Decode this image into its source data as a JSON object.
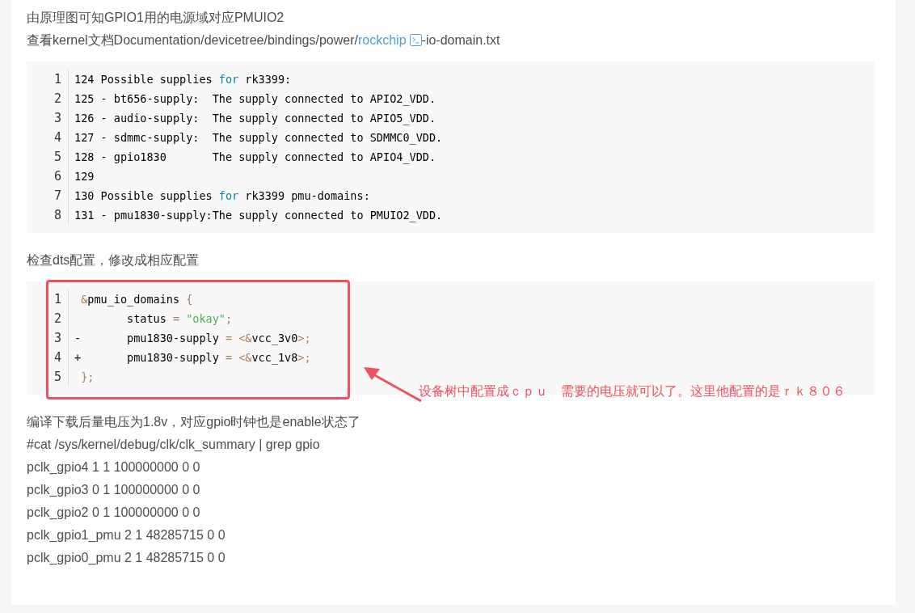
{
  "blocks": [
    {
      "kind": "text",
      "text": "由原理图可知GPIO1用的电源域对应PMUIO2"
    },
    {
      "kind": "link_text",
      "before": "查看kernel文档Documentation/devicetree/bindings/power/",
      "link": "rockchip",
      "after": "-io-domain.txt"
    },
    {
      "kind": "code",
      "lines": [
        {
          "number": "1",
          "tokens": [
            {
              "kind": "plain",
              "text": "124 Possible supplies "
            },
            {
              "kind": "keyword",
              "text": "for"
            },
            {
              "kind": "plain",
              "text": " rk3399:"
            }
          ]
        },
        {
          "number": "2",
          "tokens": [
            {
              "kind": "plain",
              "text": "125 - bt656-supply:  The supply connected to APIO2_VDD."
            }
          ]
        },
        {
          "number": "3",
          "tokens": [
            {
              "kind": "plain",
              "text": "126 - audio-supply:  The supply connected to APIO5_VDD."
            }
          ]
        },
        {
          "number": "4",
          "tokens": [
            {
              "kind": "plain",
              "text": "127 - sdmmc-supply:  The supply connected to SDMMC0_VDD."
            }
          ]
        },
        {
          "number": "5",
          "tokens": [
            {
              "kind": "plain",
              "text": "128 - gpio1830       The supply connected to APIO4_VDD."
            }
          ]
        },
        {
          "number": "6",
          "tokens": [
            {
              "kind": "plain",
              "text": "129"
            }
          ]
        },
        {
          "number": "7",
          "tokens": [
            {
              "kind": "plain",
              "text": "130 Possible supplies "
            },
            {
              "kind": "keyword",
              "text": "for"
            },
            {
              "kind": "plain",
              "text": " rk3399 pmu-domains:"
            }
          ]
        },
        {
          "number": "8",
          "tokens": [
            {
              "kind": "plain",
              "text": "131 - pmu1830-supply:The supply connected to PMUIO2_VDD."
            }
          ]
        }
      ]
    },
    {
      "kind": "text",
      "text": "检查dts配置，修改成相应配置"
    },
    {
      "kind": "code",
      "annotation": {
        "text": "设备树中配置成ｃｐｕ　需要的电压就可以了。这里他配置的是ｒｋ８０６"
      },
      "lines": [
        {
          "number": "1",
          "tokens": [
            {
              "kind": "punct",
              "text": " &"
            },
            {
              "kind": "plain",
              "text": "pmu_io_domains "
            },
            {
              "kind": "punct",
              "text": "{"
            }
          ]
        },
        {
          "number": "2",
          "tokens": [
            {
              "kind": "plain",
              "text": "        status "
            },
            {
              "kind": "punct",
              "text": "= "
            },
            {
              "kind": "string",
              "text": "\"okay\""
            },
            {
              "kind": "punct",
              "text": ";"
            }
          ]
        },
        {
          "number": "3",
          "tokens": [
            {
              "kind": "plain",
              "text": "-       pmu1830-supply "
            },
            {
              "kind": "punct",
              "text": "= <&"
            },
            {
              "kind": "plain",
              "text": "vcc_3v0"
            },
            {
              "kind": "punct",
              "text": ">;"
            }
          ]
        },
        {
          "number": "4",
          "tokens": [
            {
              "kind": "plain",
              "text": "+       pmu1830-supply "
            },
            {
              "kind": "punct",
              "text": "= <&"
            },
            {
              "kind": "plain",
              "text": "vcc_1v8"
            },
            {
              "kind": "punct",
              "text": ">;"
            }
          ]
        },
        {
          "number": "5",
          "tokens": [
            {
              "kind": "punct",
              "text": " };"
            }
          ]
        }
      ]
    },
    {
      "kind": "text",
      "text": "编译下载后量电压为1.8v，对应gpio时钟也是enable状态了"
    },
    {
      "kind": "text",
      "text": "#cat /sys/kernel/debug/clk/clk_summary | grep gpio"
    },
    {
      "kind": "text",
      "text": "pclk_gpio4 1 1 100000000 0 0"
    },
    {
      "kind": "text",
      "text": "pclk_gpio3 0 1 100000000 0 0"
    },
    {
      "kind": "text",
      "text": "pclk_gpio2 0 1 100000000 0 0"
    },
    {
      "kind": "text",
      "text": "pclk_gpio1_pmu 2 1 48285715 0 0"
    },
    {
      "kind": "text",
      "text": "pclk_gpio0_pmu 2 1 48285715 0 0"
    }
  ]
}
